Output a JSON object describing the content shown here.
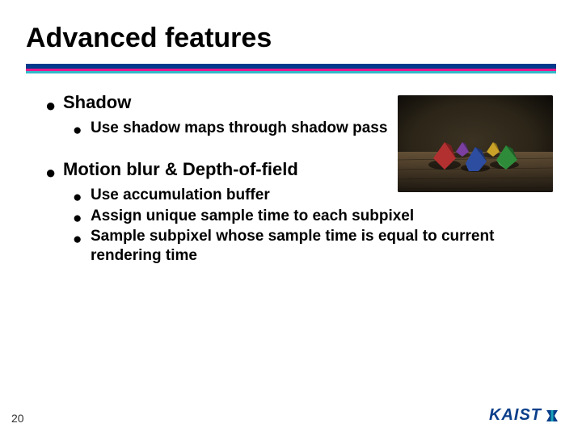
{
  "title": "Advanced features",
  "sections": [
    {
      "heading": "Shadow",
      "items": [
        "Use shadow maps through shadow pass"
      ]
    },
    {
      "heading": "Motion blur & Depth-of-field",
      "items": [
        "Use accumulation buffer",
        "Assign unique sample time to each subpixel",
        "Sample subpixel whose sample time is equal to current rendering time"
      ]
    }
  ],
  "page_number": "20",
  "logo_text": "KAIST"
}
